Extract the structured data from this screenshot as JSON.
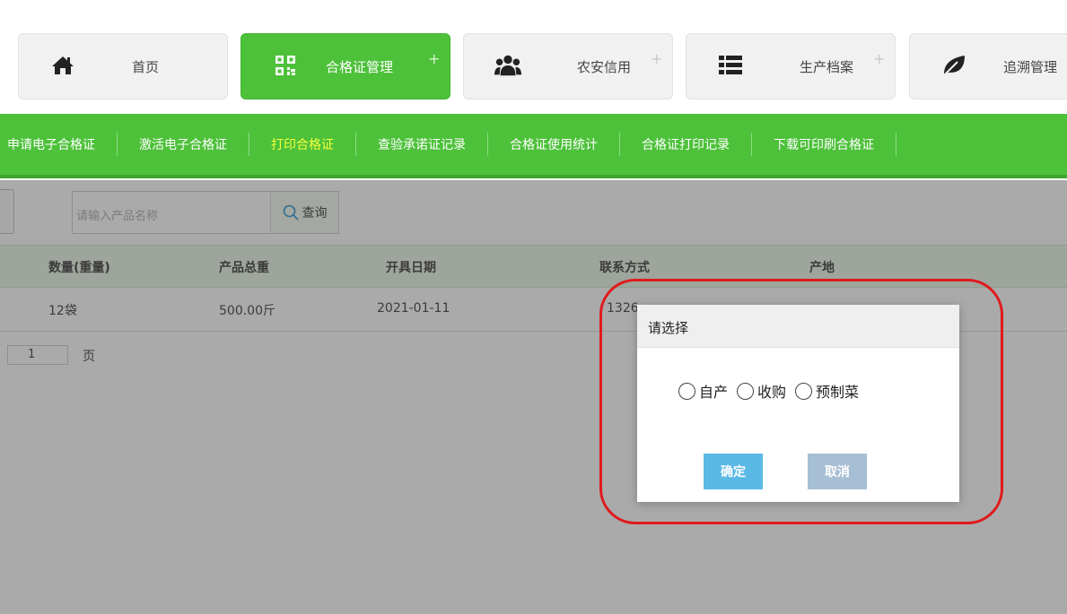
{
  "top_tabs": [
    {
      "label": "首页",
      "icon": "home-icon",
      "plus": ""
    },
    {
      "label": "合格证管理",
      "icon": "qrcode-icon",
      "plus": "+"
    },
    {
      "label": "农安信用",
      "icon": "users-icon",
      "plus": "+"
    },
    {
      "label": "生产档案",
      "icon": "list-icon",
      "plus": "+"
    },
    {
      "label": "追溯管理",
      "icon": "leaf-icon",
      "plus": ""
    }
  ],
  "active_tab": "合格证管理",
  "subnav": [
    "申请电子合格证",
    "激活电子合格证",
    "打印合格证",
    "查验承诺证记录",
    "合格证使用统计",
    "合格证打印记录",
    "下载可印刷合格证"
  ],
  "subnav_current": "打印合格证",
  "search": {
    "placeholder": "请输入产品名称",
    "button_label": "查询"
  },
  "table": {
    "headers": [
      "数量(重量)",
      "产品总重",
      "开具日期",
      "联系方式",
      "产地"
    ],
    "rows": [
      [
        "12袋",
        "500.00斤",
        "2021-01-11",
        "1326",
        ""
      ]
    ]
  },
  "pager": {
    "page": "1",
    "suffix": "页"
  },
  "dialog": {
    "title": "请选择",
    "options": [
      "自产",
      "收购",
      "预制菜"
    ],
    "ok_label": "确定",
    "cancel_label": "取消"
  },
  "colors": {
    "brand_green": "#4dc13a",
    "subnav_current": "#f5ff3c",
    "ok_button": "#5bb9e6",
    "cancel_button": "#a7bfd4",
    "highlight_ring": "#e0191d"
  }
}
